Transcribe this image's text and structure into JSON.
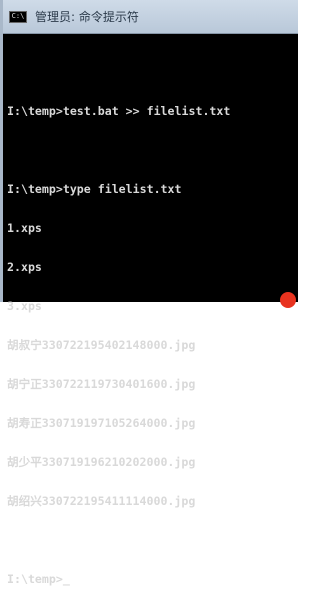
{
  "window": {
    "title": "管理员: 命令提示符",
    "icon": "cmd-icon",
    "icon_glyph": "C:\\"
  },
  "console": {
    "lines": [
      "",
      "I:\\temp>test.bat >> filelist.txt",
      "",
      "I:\\temp>type filelist.txt",
      "1.xps",
      "2.xps",
      "3.xps",
      "胡叔宁330722195402148000.jpg",
      "胡宁正330722119730401600.jpg",
      "胡寿正330719197105264000.jpg",
      "胡少平330719196210202000.jpg",
      "胡绍兴330722195411114000.jpg",
      "",
      "I:\\temp>_"
    ]
  },
  "colors": {
    "console_bg": "#000000",
    "console_fg": "#d9d9d9",
    "titlebar": "#c3d0de",
    "badge": "#e8331f"
  }
}
